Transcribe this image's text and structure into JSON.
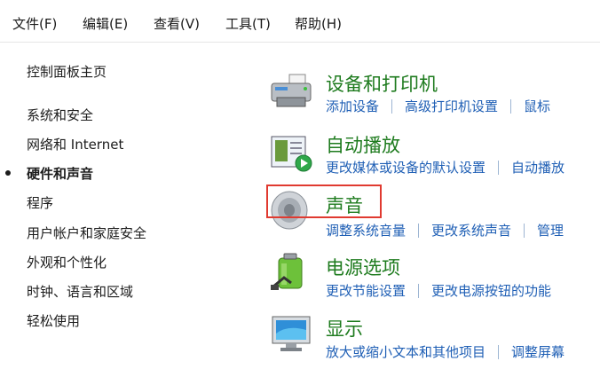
{
  "menu": [
    "文件(F)",
    "编辑(E)",
    "查看(V)",
    "工具(T)",
    "帮助(H)"
  ],
  "sidebar": {
    "home": "控制面板主页",
    "items": [
      {
        "label": "系统和安全"
      },
      {
        "label": "网络和 Internet"
      },
      {
        "label": "硬件和声音",
        "active": true
      },
      {
        "label": "程序"
      },
      {
        "label": "用户帐户和家庭安全"
      },
      {
        "label": "外观和个性化"
      },
      {
        "label": "时钟、语言和区域"
      },
      {
        "label": "轻松使用"
      }
    ]
  },
  "categories": [
    {
      "title": "设备和打印机",
      "icon": "printer-device-icon",
      "links": [
        "添加设备",
        "高级打印机设置",
        "鼠标"
      ]
    },
    {
      "title": "自动播放",
      "icon": "autoplay-icon",
      "links": [
        "更改媒体或设备的默认设置",
        "自动播放"
      ]
    },
    {
      "title": "声音",
      "icon": "speaker-icon",
      "links": [
        "调整系统音量",
        "更改系统声音",
        "管理"
      ]
    },
    {
      "title": "电源选项",
      "icon": "battery-power-icon",
      "links": [
        "更改节能设置",
        "更改电源按钮的功能"
      ]
    },
    {
      "title": "显示",
      "icon": "monitor-icon",
      "links": [
        "放大或缩小文本和其他项目",
        "调整屏幕"
      ]
    }
  ],
  "colors": {
    "category_title": "#1e7b1e",
    "link": "#1f5fb5",
    "highlight_border": "#e03a30"
  }
}
